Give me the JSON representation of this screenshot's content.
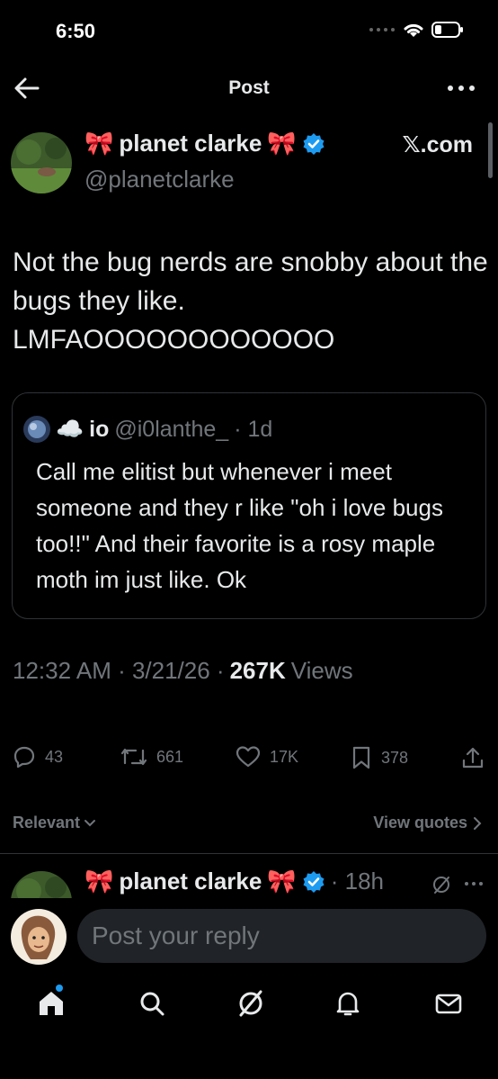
{
  "status_bar": {
    "time": "6:50"
  },
  "nav": {
    "title": "Post"
  },
  "author": {
    "name": "planet clarke",
    "handle": "@planetclarke",
    "source": "𝕏.com",
    "emoji": "🎀"
  },
  "tweet": {
    "text": "Not the bug nerds are snobby about the bugs they like.\nLMFAOOOOOOOOOOOO"
  },
  "quote": {
    "emoji": "☁️",
    "name": "io",
    "handle": "@i0lanthe_",
    "time": "· 1d",
    "text": "Call me elitist but whenever i meet someone and they r like \"oh i love bugs too!!\" And their favorite is a rosy maple moth im just like. Ok"
  },
  "meta": {
    "timestamp": "12:32 AM · 3/21/26 ·",
    "views_count": "267K",
    "views_label": "Views"
  },
  "actions": {
    "replies": "43",
    "reposts": "661",
    "likes": "17K",
    "bookmarks": "378"
  },
  "filters": {
    "relevant": "Relevant",
    "view_quotes": "View quotes"
  },
  "reply_preview": {
    "name": "planet clarke",
    "time": "· 18h",
    "emoji": "🎀"
  },
  "compose": {
    "placeholder": "Post your reply"
  },
  "colors": {
    "accent": "#1d9bf0",
    "muted": "#71767b",
    "text": "#e7e9ea",
    "border": "#2f3336",
    "pink": "#f48fb1"
  }
}
